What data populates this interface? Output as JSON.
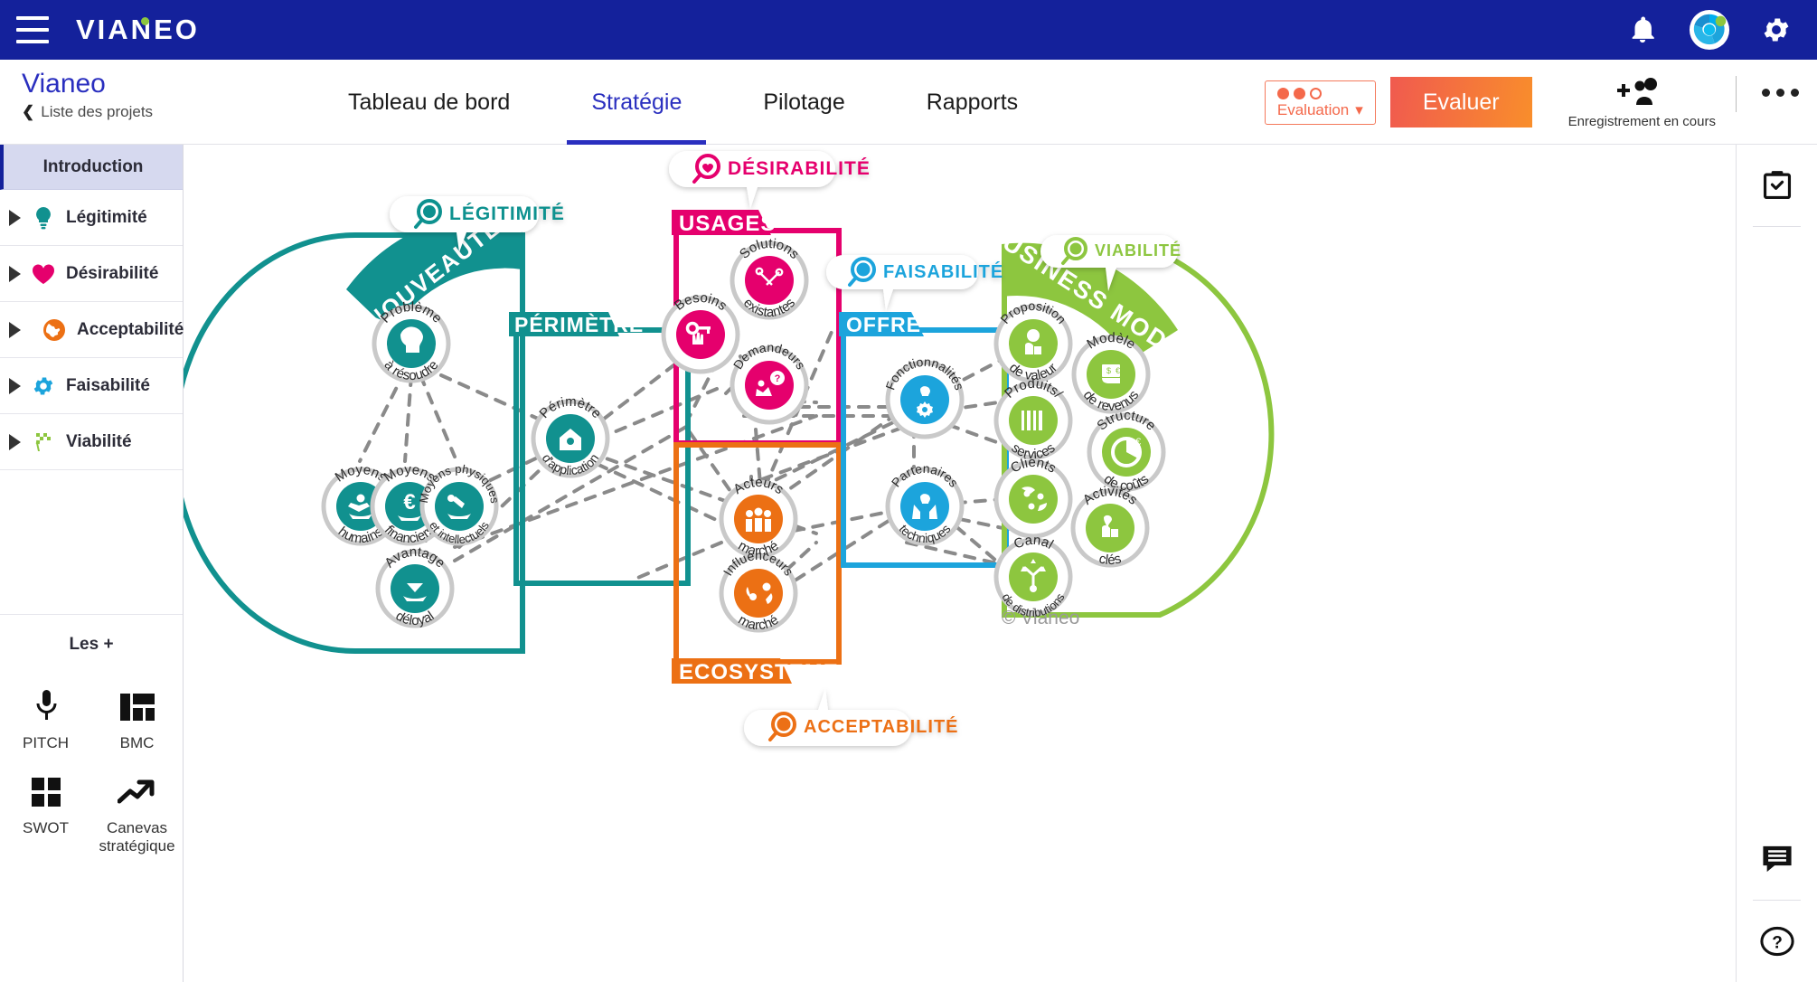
{
  "topbar": {
    "logo_text": "VIANEO",
    "menu_icon": "hamburger-menu-icon",
    "icons": [
      "bell-icon",
      "vianeo-avatar-icon",
      "gear-icon"
    ]
  },
  "header": {
    "project_name": "Vianeo",
    "back_label": "Liste des projets",
    "tabs": [
      {
        "label": "Tableau de bord",
        "active": false
      },
      {
        "label": "Stratégie",
        "active": true
      },
      {
        "label": "Pilotage",
        "active": false
      },
      {
        "label": "Rapports",
        "active": false
      }
    ],
    "evaluation_select": {
      "label": "Evaluation",
      "dots_filled": 2,
      "dots_total": 3
    },
    "evaluate_button": "Evaluer",
    "share_label": "Enregistrement en cours",
    "more_menu": "more-options-icon"
  },
  "sidebar": {
    "intro": "Introduction",
    "items": [
      {
        "label": "Légitimité",
        "color": "#11918F",
        "icon": "lightbulb-icon"
      },
      {
        "label": "Désirabilité",
        "color": "#E5006D",
        "icon": "heart-icon"
      },
      {
        "label": "Acceptabilité",
        "color": "#EC7014",
        "icon": "globe-icon"
      },
      {
        "label": "Faisabilité",
        "color": "#1CA4DC",
        "icon": "gear-icon"
      },
      {
        "label": "Viabilité",
        "color": "#8DC63F",
        "icon": "checkered-flag-icon"
      }
    ],
    "extras_title": "Les +",
    "tools": [
      {
        "label": "PITCH",
        "icon": "microphone-icon"
      },
      {
        "label": "BMC",
        "icon": "layout-blocks-icon"
      },
      {
        "label": "SWOT",
        "icon": "four-squares-icon"
      },
      {
        "label": "Canevas stratégique",
        "icon": "trend-arrow-icon"
      }
    ]
  },
  "rail": {
    "buttons": [
      {
        "name": "clipboard-check-icon"
      },
      {
        "name": "comment-icon"
      },
      {
        "name": "help-icon"
      }
    ]
  },
  "diagram": {
    "copyright": "© Vianeo",
    "callouts": [
      {
        "id": "legitimite",
        "label": "LÉGITIMITÉ",
        "color": "#11918F"
      },
      {
        "id": "desirabilite",
        "label": "DÉSIRABILITÉ",
        "color": "#E5006D"
      },
      {
        "id": "faisabilite",
        "label": "FAISABILITÉ",
        "color": "#1CA4DC"
      },
      {
        "id": "viabilite",
        "label": "VIABILITÉ",
        "color": "#8DC63F"
      },
      {
        "id": "acceptabilite",
        "label": "ACCEPTABILITÉ",
        "color": "#EC7014"
      }
    ],
    "zones": [
      {
        "id": "nouveaute",
        "label": "NOUVEAUTÉ",
        "color": "#11918F"
      },
      {
        "id": "perimetre",
        "label": "PÉRIMÈTRE",
        "color": "#11918F"
      },
      {
        "id": "usages",
        "label": "USAGES",
        "color": "#E5006D"
      },
      {
        "id": "offre",
        "label": "OFFRE",
        "color": "#1CA4DC"
      },
      {
        "id": "ecosysteme",
        "label": "ECOSYSTEME",
        "color": "#EC7014"
      },
      {
        "id": "business_model",
        "label": "BUSINESS MODEL",
        "color": "#8DC63F"
      }
    ],
    "nodes": [
      {
        "id": "probleme",
        "top": "Problème",
        "bottom": "à résoudre",
        "color": "#11918F",
        "icon": "head-question-icon"
      },
      {
        "id": "moyens_humains",
        "top": "Moyens",
        "bottom": "humains",
        "color": "#11918F",
        "icon": "hand-person-icon"
      },
      {
        "id": "moyens_fin",
        "top": "Moyens",
        "bottom": "financiers",
        "color": "#11918F",
        "icon": "hand-euro-icon"
      },
      {
        "id": "moyens_phys",
        "top": "Moyens physiques",
        "bottom": "et intellectuels",
        "color": "#11918F",
        "icon": "hand-wrench-icon"
      },
      {
        "id": "avantage",
        "top": "Avantage",
        "bottom": "déloyal",
        "color": "#11918F",
        "icon": "hand-diamond-icon"
      },
      {
        "id": "perimetre_app",
        "top": "Périmètre",
        "bottom": "d'application",
        "color": "#11918F",
        "icon": "house-bulb-icon"
      },
      {
        "id": "solutions",
        "top": "Solutions",
        "bottom": "existantes",
        "color": "#E5006D",
        "icon": "tools-icon"
      },
      {
        "id": "besoins",
        "top": "Besoins",
        "bottom": "",
        "color": "#E5006D",
        "icon": "key-hand-icon"
      },
      {
        "id": "demandeurs",
        "top": "Demandeurs",
        "bottom": "",
        "color": "#E5006D",
        "icon": "person-question-icon"
      },
      {
        "id": "acteurs",
        "top": "Acteurs",
        "bottom": "marché",
        "color": "#EC7014",
        "icon": "people-group-icon"
      },
      {
        "id": "influenceurs",
        "top": "Influenceurs",
        "bottom": "marché",
        "color": "#EC7014",
        "icon": "influence-icon"
      },
      {
        "id": "fonctionnalites",
        "top": "Fonctionnalités",
        "bottom": "",
        "color": "#1CA4DC",
        "icon": "bulb-gear-icon"
      },
      {
        "id": "partenaires",
        "top": "Partenaires",
        "bottom": "techniques",
        "color": "#1CA4DC",
        "icon": "hands-bulb-icon"
      },
      {
        "id": "proposition",
        "top": "Proposition",
        "bottom": "de valeur",
        "color": "#8DC63F",
        "icon": "hand-bulb-icon"
      },
      {
        "id": "produits",
        "top": "Produits/",
        "bottom": "services",
        "color": "#8DC63F",
        "icon": "barcode-icon"
      },
      {
        "id": "clients",
        "top": "Clients",
        "bottom": "",
        "color": "#8DC63F",
        "icon": "clients-icon"
      },
      {
        "id": "canal",
        "top": "Canal",
        "bottom": "de distributions",
        "color": "#8DC63F",
        "icon": "distribution-icon"
      },
      {
        "id": "modele_rev",
        "top": "Modèle",
        "bottom": "de revenus",
        "color": "#8DC63F",
        "icon": "money-hand-icon"
      },
      {
        "id": "structure",
        "top": "Structure",
        "bottom": "de coûts",
        "color": "#8DC63F",
        "icon": "pie-euro-icon"
      },
      {
        "id": "activites",
        "top": "Activités",
        "bottom": "clés",
        "color": "#8DC63F",
        "icon": "hand-heart-icon"
      }
    ]
  }
}
